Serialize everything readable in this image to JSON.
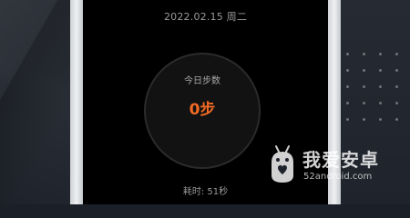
{
  "screen": {
    "date": "2022.02.15 周二",
    "steps_label": "今日步数",
    "steps_value": "0步",
    "elapsed": "耗时: 51秒"
  },
  "watermark": {
    "title": "我爱安卓",
    "domain": "52android.com"
  },
  "colors": {
    "accent": "#f06a24",
    "screen_bg": "#000000",
    "ring_bg": "#121212"
  }
}
